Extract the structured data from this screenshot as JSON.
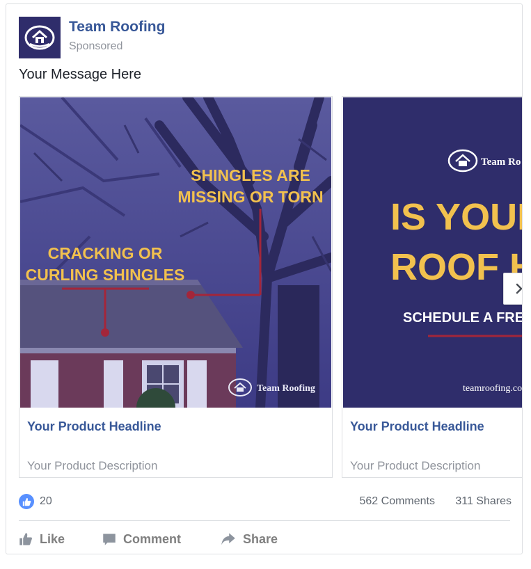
{
  "post": {
    "page_name": "Team Roofing",
    "sponsored_label": "Sponsored",
    "message": "Your Message Here"
  },
  "carousel": {
    "slides": [
      {
        "image": {
          "callout_right_line1": "SHINGLES ARE",
          "callout_right_line2": "MISSING OR TORN",
          "callout_left_line1": "CRACKING OR",
          "callout_left_line2": "CURLING SHINGLES",
          "watermark": "Team Roofing"
        },
        "headline": "Your Product Headline",
        "description": "Your Product Description"
      },
      {
        "image": {
          "brand": "Team Ro",
          "line1": "IS YOUR H",
          "line2": "ROOF HEA",
          "cta": "SCHEDULE A FREE I",
          "url": "teamroofing.co"
        },
        "headline": "Your Product Headline",
        "description": "Your Product Description"
      }
    ],
    "next_icon": "chevron-right-icon"
  },
  "stats": {
    "likes": "20",
    "comments": "562 Comments",
    "shares": "311 Shares"
  },
  "actions": {
    "like": "Like",
    "comment": "Comment",
    "share": "Share"
  },
  "colors": {
    "brand_navy": "#2f2d6b",
    "link_blue": "#385898",
    "callout_yellow": "#f2c14e",
    "callout_red": "#a3263a",
    "like_blue": "#5890ff"
  }
}
